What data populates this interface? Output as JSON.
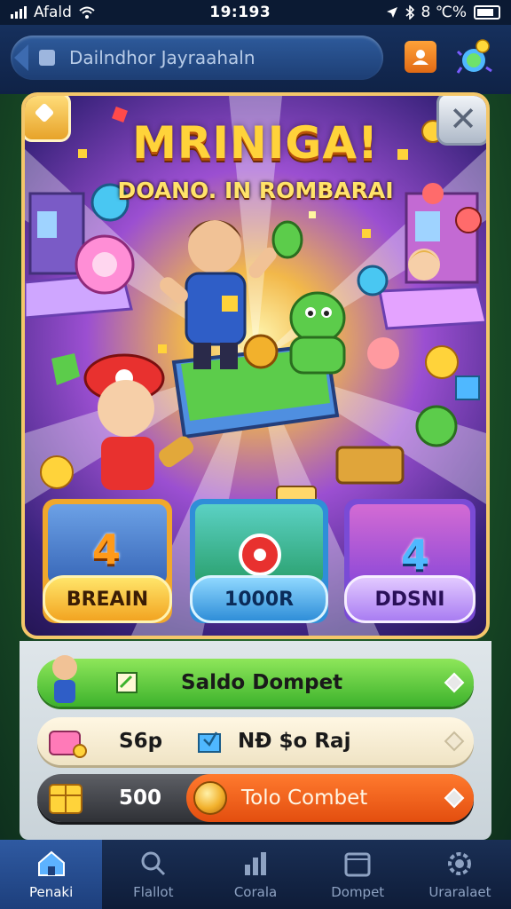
{
  "status_bar": {
    "carrier": "Afald",
    "time": "19:193",
    "battery_text": "8 ℃%",
    "icons": [
      "signal-icon",
      "wifi-icon",
      "location-icon",
      "bluetooth-icon",
      "battery-icon"
    ]
  },
  "header": {
    "search_text": "Dailndhor Jayraahaln",
    "icons": [
      "lock-icon",
      "profile-icon",
      "bug-icon"
    ]
  },
  "banner": {
    "title": "MRINIGA!",
    "subtitle": "DOANO. IN ROMBARAI",
    "promo_cards": [
      {
        "label": "BREAIN",
        "number": "4"
      },
      {
        "label": "1000R",
        "number": ""
      },
      {
        "label": "DDSNI",
        "number": "4"
      }
    ]
  },
  "wallet": {
    "rows": [
      {
        "label": "Saldo Dompet"
      },
      {
        "label_left": "S6p",
        "label_right": "NÐ $o Raj"
      },
      {
        "label_left": "500",
        "label_right": "Tolo Combet"
      }
    ]
  },
  "nav": {
    "items": [
      {
        "label": "Penaki",
        "icon": "home-icon",
        "active": true
      },
      {
        "label": "Flallot",
        "icon": "search-icon",
        "active": false
      },
      {
        "label": "Corala",
        "icon": "chart-icon",
        "active": false
      },
      {
        "label": "Dompet",
        "icon": "wallet-icon",
        "active": false
      },
      {
        "label": "Uraralaet",
        "icon": "settings-icon",
        "active": false
      }
    ]
  },
  "colors": {
    "accent_gold": "#ffd33a",
    "nav_bg": "#0e1c38",
    "green_row": "#3db22c",
    "orange_pill": "#e34e0f"
  }
}
